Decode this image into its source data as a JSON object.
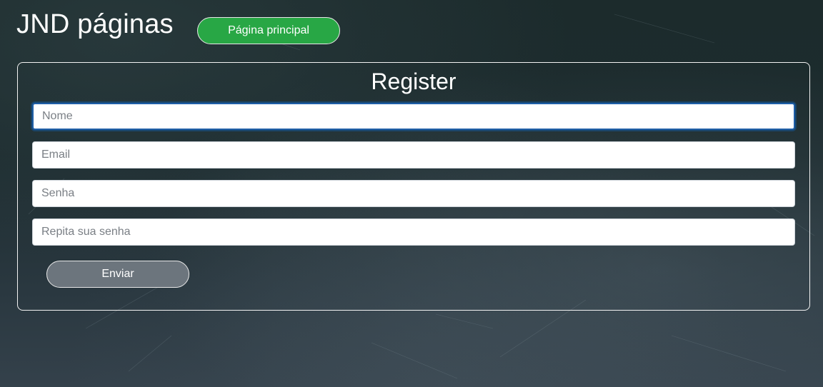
{
  "header": {
    "brand": "JND páginas",
    "home_button_label": "Página principal"
  },
  "register": {
    "title": "Register",
    "fields": {
      "nome_placeholder": "Nome",
      "email_placeholder": "Email",
      "senha_placeholder": "Senha",
      "repeat_placeholder": "Repita sua senha"
    },
    "submit_label": "Enviar"
  },
  "colors": {
    "primary_button": "#28a745",
    "secondary_button": "#6c757d",
    "background": "#1d2c2f",
    "focus_border": "#1f5fa8"
  }
}
